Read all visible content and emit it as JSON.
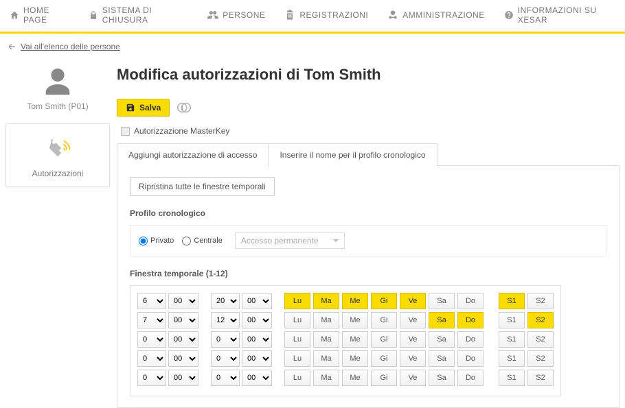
{
  "nav": {
    "home": "HOME PAGE",
    "locking": "SISTEMA DI CHIUSURA",
    "persons": "PERSONE",
    "logs": "REGISTRAZIONI",
    "admin": "AMMINISTRAZIONE",
    "info": "INFORMAZIONI SU XESAR"
  },
  "breadcrumb": {
    "back_label": "Vai all'elenco delle persone"
  },
  "sidebar": {
    "person_name": "Tom Smith (P01)",
    "auth_tab_label": "Autorizzazioni"
  },
  "page": {
    "title": "Modifica autorizzazioni di Tom Smith"
  },
  "toolbar": {
    "save_label": "Salva",
    "counter": "1"
  },
  "masterkey": {
    "label": "Autorizzazione MasterKey",
    "checked": false
  },
  "tabs": {
    "add_access": "Aggiungi autorizzazione di accesso",
    "time_profile": "Inserire il nome per il profilo cronologico"
  },
  "buttons": {
    "reset_windows": "Ripristina tutte le finestre temporali"
  },
  "sections": {
    "profile_label": "Profilo cronologico",
    "time_window_label": "Finestra temporale (1-12)"
  },
  "profile": {
    "private_label": "Privato",
    "central_label": "Centrale",
    "selected": "private",
    "dropdown_placeholder": "Accesso permanente"
  },
  "days": {
    "headers": [
      "Lu",
      "Ma",
      "Me",
      "Gi",
      "Ve",
      "Sa",
      "Do"
    ],
    "s_headers": [
      "S1",
      "S2"
    ]
  },
  "time_rows": [
    {
      "from_h": "6",
      "from_m": "00",
      "to_h": "20",
      "to_m": "00",
      "days": [
        true,
        true,
        true,
        true,
        true,
        false,
        false
      ],
      "s": [
        true,
        false
      ]
    },
    {
      "from_h": "7",
      "from_m": "00",
      "to_h": "12",
      "to_m": "00",
      "days": [
        false,
        false,
        false,
        false,
        false,
        true,
        true
      ],
      "s": [
        false,
        true
      ]
    },
    {
      "from_h": "0",
      "from_m": "00",
      "to_h": "0",
      "to_m": "00",
      "days": [
        false,
        false,
        false,
        false,
        false,
        false,
        false
      ],
      "s": [
        false,
        false
      ]
    },
    {
      "from_h": "0",
      "from_m": "00",
      "to_h": "0",
      "to_m": "00",
      "days": [
        false,
        false,
        false,
        false,
        false,
        false,
        false
      ],
      "s": [
        false,
        false
      ]
    },
    {
      "from_h": "0",
      "from_m": "00",
      "to_h": "0",
      "to_m": "00",
      "days": [
        false,
        false,
        false,
        false,
        false,
        false,
        false
      ],
      "s": [
        false,
        false
      ]
    }
  ]
}
